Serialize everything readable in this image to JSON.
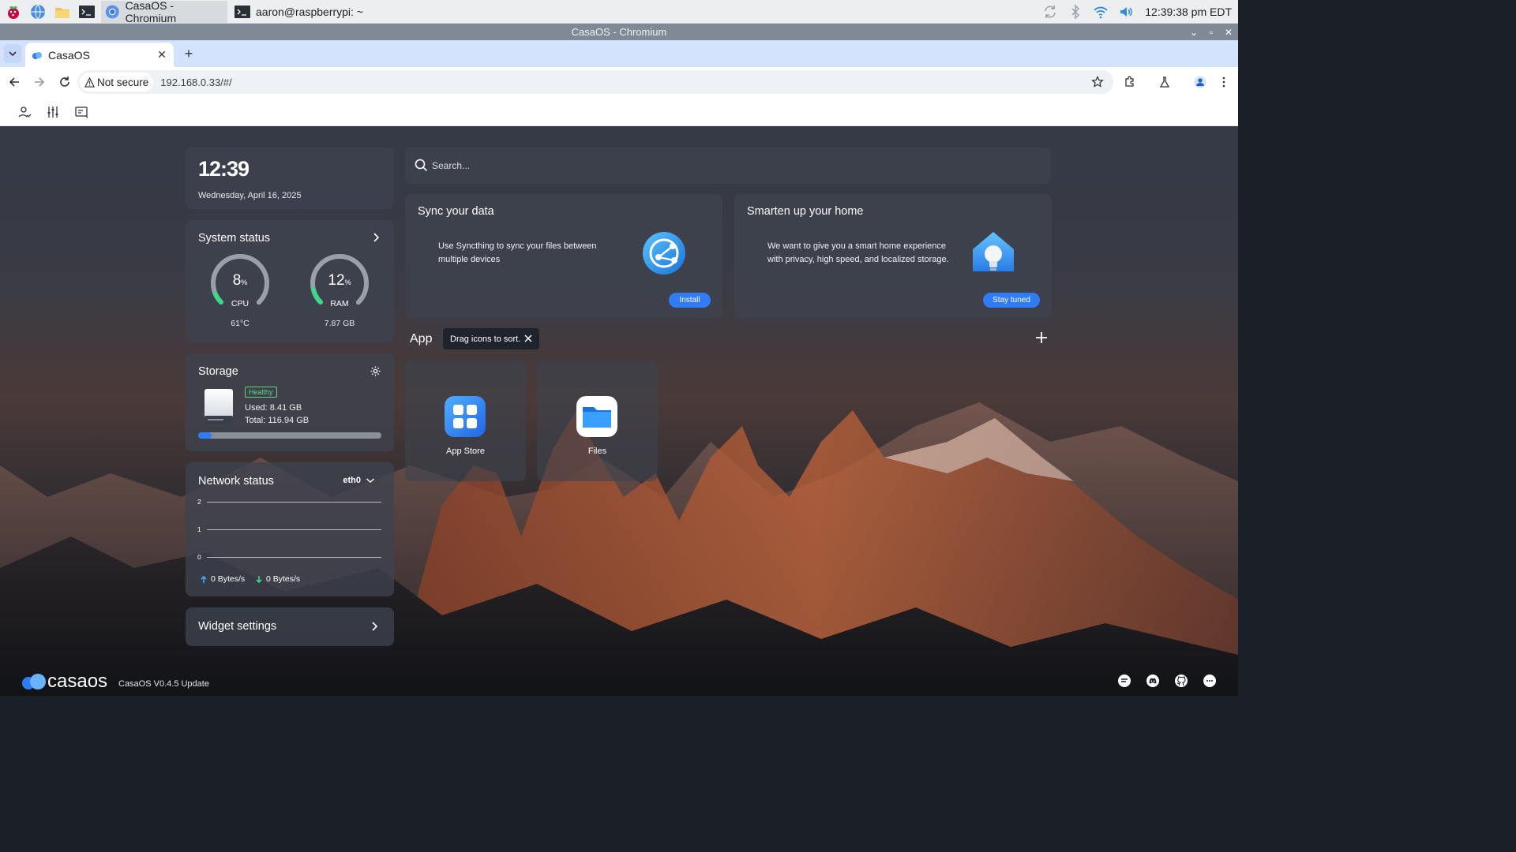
{
  "taskbar": {
    "tasks": [
      {
        "label": "CasaOS - Chromium"
      },
      {
        "label": "aaron@raspberrypi: ~"
      }
    ],
    "clock": "12:39:38 pm EDT"
  },
  "window": {
    "title": "CasaOS - Chromium"
  },
  "browser": {
    "tab_title": "CasaOS",
    "security_label": "Not secure",
    "url": "192.168.0.33/#/"
  },
  "casaos": {
    "time": "12:39",
    "date": "Wednesday, April 16, 2025",
    "system_status": {
      "title": "System status",
      "cpu": {
        "value": 8,
        "unit": "%",
        "label": "CPU",
        "sub": "61°C"
      },
      "ram": {
        "value": 12,
        "unit": "%",
        "label": "RAM",
        "sub": "7.87 GB"
      }
    },
    "storage": {
      "title": "Storage",
      "status": "Healthy",
      "used": "Used: 8.41 GB",
      "total": "Total: 116.94 GB",
      "used_fraction": 0.072
    },
    "network": {
      "title": "Network status",
      "interface": "eth0",
      "ticks": [
        "2",
        "1",
        "0"
      ],
      "upload": "0 Bytes/s",
      "download": "0 Bytes/s"
    },
    "widget_settings": {
      "title": "Widget settings"
    },
    "search": {
      "placeholder": "Search..."
    },
    "promos": [
      {
        "title": "Sync your data",
        "desc": "Use Syncthing to sync your files between multiple devices",
        "button": "Install"
      },
      {
        "title": "Smarten up your home",
        "desc": "We want to give you a smart home experience with privacy, high speed, and localized storage.",
        "button": "Stay tuned"
      }
    ],
    "apps_header": "App",
    "apps_tip": "Drag icons to sort.",
    "apps": [
      {
        "label": "App Store"
      },
      {
        "label": "Files"
      }
    ],
    "footer": {
      "logo": "casaos",
      "version": "CasaOS V0.4.5 Update"
    }
  },
  "colors": {
    "accent": "#2f7cf6",
    "healthy": "#5bd68a",
    "gauge": "#3dd68c"
  }
}
